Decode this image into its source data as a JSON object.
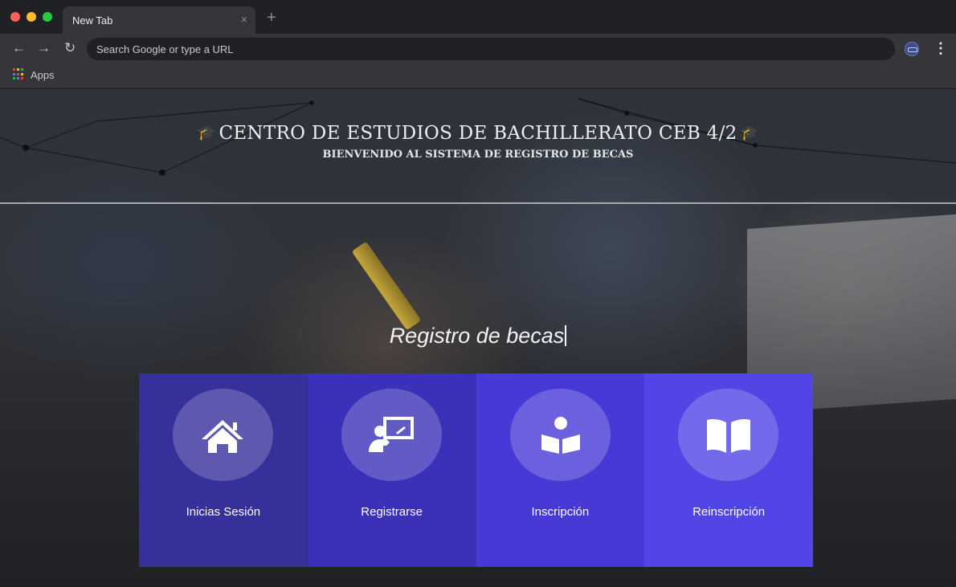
{
  "browser": {
    "tab_title": "New Tab",
    "tab_close": "×",
    "new_tab": "+",
    "back": "←",
    "forward": "→",
    "reload": "↻",
    "omnibox_placeholder": "Search Google or type a URL",
    "menu": "⋮",
    "bookmarks": {
      "apps_label": "Apps"
    }
  },
  "page": {
    "title": "CENTRO DE ESTUDIOS DE BACHILLERATO CEB 4/2",
    "subtitle": "BIENVENIDO AL SISTEMA DE REGISTRO DE BECAS",
    "typed_text": "Registro de becas",
    "cards": [
      {
        "label": "Inicias Sesión",
        "icon": "home-icon",
        "color": "#36309a"
      },
      {
        "label": "Registrarse",
        "icon": "presentation-icon",
        "color": "#3b31b8"
      },
      {
        "label": "Inscripción",
        "icon": "reader-icon",
        "color": "#4739d6"
      },
      {
        "label": "Reinscripción",
        "icon": "open-book-icon",
        "color": "#5145e6"
      }
    ]
  },
  "colors": {
    "traffic_red": "#ff5f57",
    "traffic_yellow": "#febc2e",
    "traffic_green": "#28c840"
  }
}
